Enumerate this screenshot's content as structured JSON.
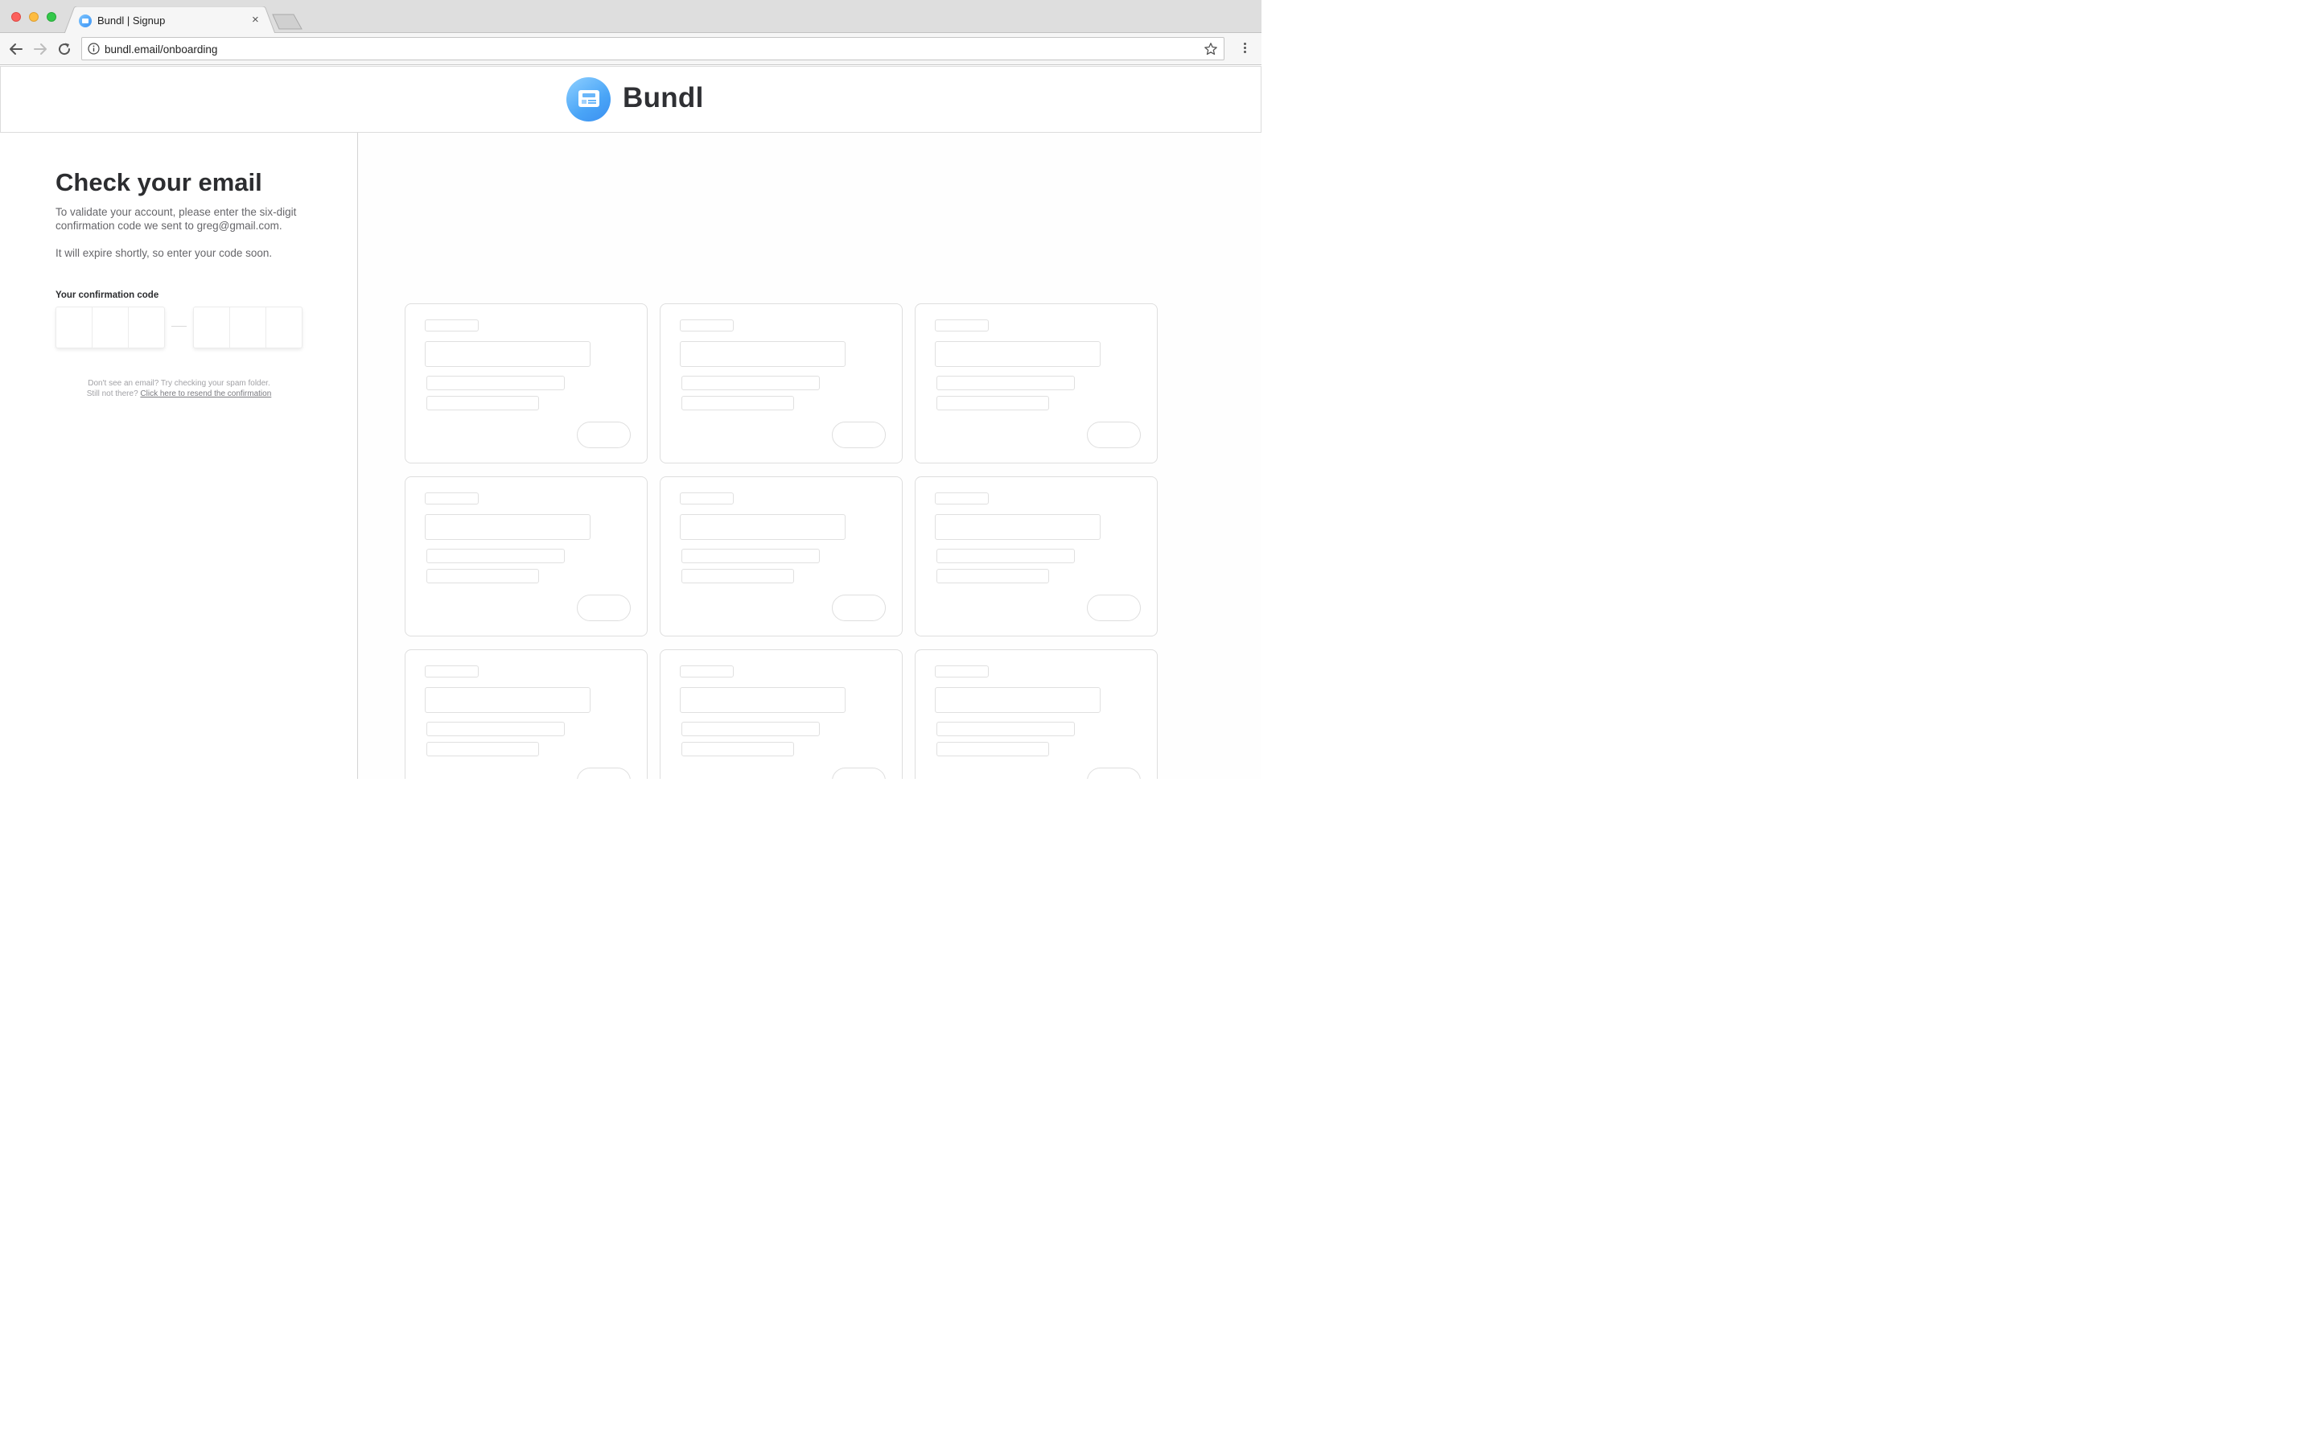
{
  "browser": {
    "tab_title": "Bundl | Signup",
    "close_glyph": "×",
    "url": "bundl.email/onboarding",
    "icons": [
      "back-arrow-icon",
      "forward-arrow-icon",
      "reload-icon",
      "info-icon",
      "star-icon",
      "more-vertical-icon"
    ]
  },
  "header": {
    "brand": "Bundl",
    "logo_icon": "envelope-logo-icon",
    "brand_color": "#4aa5f7"
  },
  "verify": {
    "title": "Check your email",
    "description": "To validate your account, please enter the six-digit confirmation code we sent to greg@gmail.com.",
    "expire_note": "It will expire shortly, so enter your code soon.",
    "code_label": "Your confirmation code",
    "code_digits": [
      "",
      "",
      "",
      "",
      "",
      ""
    ],
    "help_line1": "Don't see an email? Try checking your spam folder.",
    "help_line2_prefix": "Still not there?",
    "resend_link": "Click here to resend the confirmation"
  },
  "placeholder_grid": {
    "columns": 3,
    "rows": 3,
    "style": "skeleton wireframe cards"
  }
}
